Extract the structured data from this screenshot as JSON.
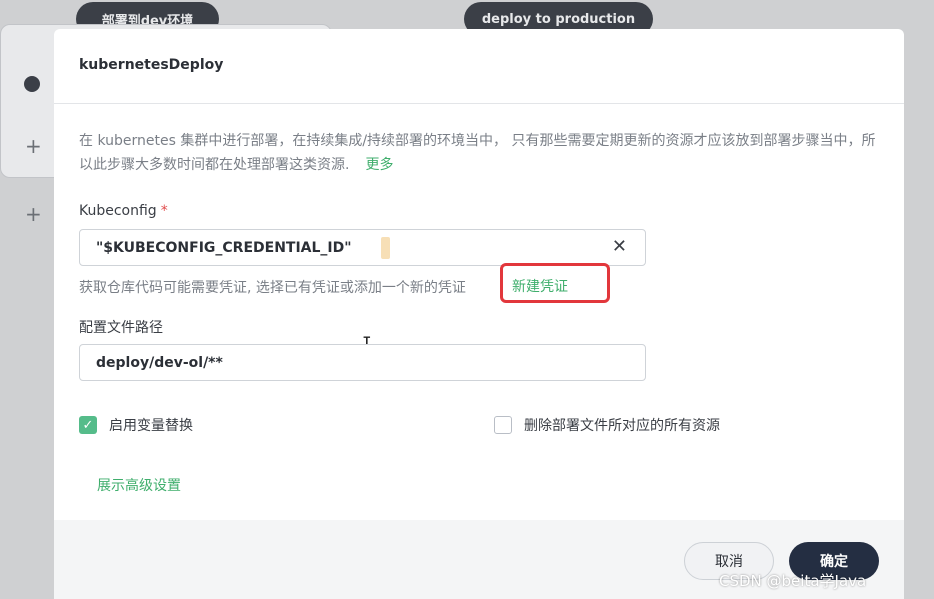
{
  "background": {
    "pill_left": "部署到dev环境",
    "pill_right": "deploy to production"
  },
  "modal": {
    "title": "kubernetesDeploy",
    "description": "在 kubernetes 集群中进行部署，在持续集成/持续部署的环境当中， 只有那些需要定期更新的资源才应该放到部署步骤当中，所以此步骤大多数时间都在处理部署这类资源.",
    "more_link": "更多",
    "kubeconfig": {
      "label": "Kubeconfig",
      "required_mark": "*",
      "value": "\"$KUBECONFIG_CREDENTIAL_ID\"",
      "clear_icon": "✕",
      "hint": "获取仓库代码可能需要凭证, 选择已有凭证或添加一个新的凭证",
      "new_credential_link": "新建凭证"
    },
    "config_path": {
      "label": "配置文件路径",
      "value": "deploy/dev-ol/**"
    },
    "enable_var_substitution": {
      "label": "启用变量替换",
      "checked": true
    },
    "delete_resources": {
      "label": "删除部署文件所对应的所有资源",
      "checked": false
    },
    "advanced_link": "展示高级设置",
    "buttons": {
      "cancel": "取消",
      "confirm": "确定"
    }
  },
  "watermark": "CSDN @beita学Java",
  "colors": {
    "accent_green": "#3fae6c",
    "checkbox_green": "#55bc8a",
    "primary_button": "#242e42",
    "highlight_red": "#e2373c"
  }
}
